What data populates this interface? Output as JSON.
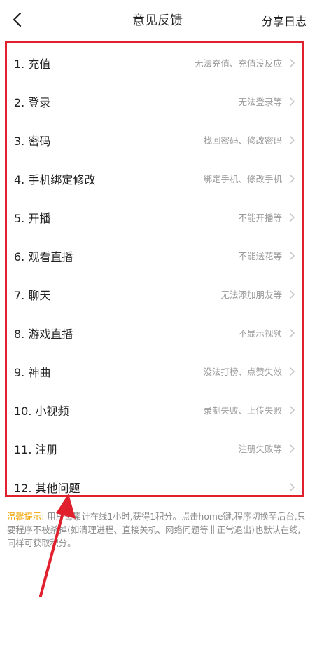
{
  "header": {
    "title": "意见反馈",
    "share_label": "分享日志"
  },
  "items": [
    {
      "label": "1. 充值",
      "hint": "无法充值、充值没反应"
    },
    {
      "label": "2. 登录",
      "hint": "无法登录等"
    },
    {
      "label": "3. 密码",
      "hint": "找回密码、修改密码"
    },
    {
      "label": "4. 手机绑定修改",
      "hint": "绑定手机、修改手机"
    },
    {
      "label": "5. 开播",
      "hint": "不能开播等"
    },
    {
      "label": "6. 观看直播",
      "hint": "不能送花等"
    },
    {
      "label": "7. 聊天",
      "hint": "无法添加朋友等"
    },
    {
      "label": "8. 游戏直播",
      "hint": "不显示视频"
    },
    {
      "label": "9. 神曲",
      "hint": "没法打榜、点赞失效"
    },
    {
      "label": "10. 小视频",
      "hint": "录制失败、上传失败"
    },
    {
      "label": "11. 注册",
      "hint": "注册失败等"
    },
    {
      "label": "12. 其他问题",
      "hint": ""
    }
  ],
  "notice": {
    "label": "温馨提示:",
    "text": " 用户每累计在线1小时,获得1积分。点击home键,程序切换至后台,只要程序不被杀掉(如清理进程、直接关机、网络问题等非正常退出)也默认在线,同样可获取积分。"
  },
  "colors": {
    "highlight_border": "#e0202c",
    "notice_label": "#f0a400",
    "hint_text": "#9a9a9a"
  }
}
